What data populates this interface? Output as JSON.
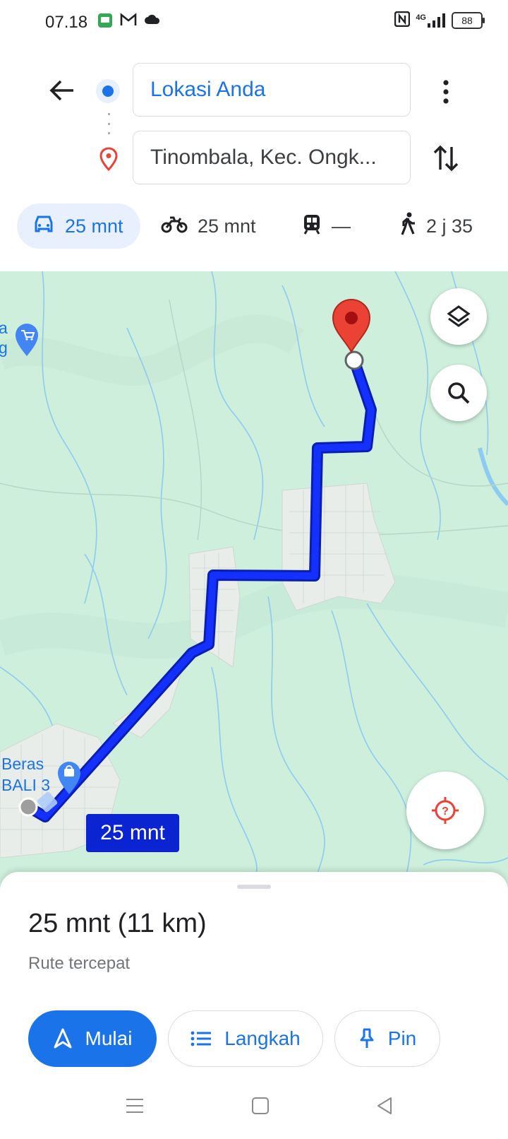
{
  "status_bar": {
    "time": "07.18",
    "network": "4G",
    "battery": "88"
  },
  "directions": {
    "origin": "Lokasi Anda",
    "destination": "Tinombala, Kec. Ongk..."
  },
  "modes": [
    {
      "name": "car",
      "value": "25 mnt",
      "active": true
    },
    {
      "name": "motorcycle",
      "value": "25 mnt",
      "active": false
    },
    {
      "name": "transit",
      "value": "—",
      "active": false
    },
    {
      "name": "walk",
      "value": "2 j 35",
      "active": false
    }
  ],
  "map": {
    "route_label": "25 mnt",
    "poi_left_top_lines": [
      "a",
      "g"
    ],
    "poi_bottom_lines": [
      "Beras",
      "BALI 3"
    ],
    "route_color": "#0b24d1",
    "map_bg": "#cdefdc"
  },
  "sheet": {
    "summary": "25 mnt (11 km)",
    "subtitle": "Rute tercepat",
    "start_label": "Mulai",
    "steps_label": "Langkah",
    "pin_label": "Pin"
  },
  "colors": {
    "accent": "#1a73e8",
    "destination_pin": "#ea4335"
  }
}
